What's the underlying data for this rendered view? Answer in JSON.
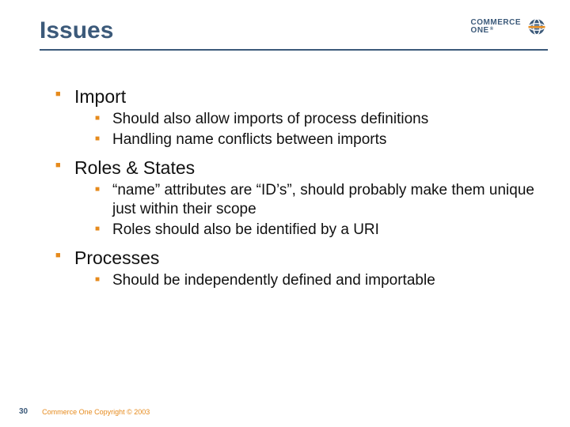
{
  "logo": {
    "line1": "COMMERCE",
    "line2": "ONE",
    "reg": "®"
  },
  "title": "Issues",
  "bullets": [
    {
      "label": "Import",
      "sub": [
        "Should also allow imports of process definitions",
        "Handling name conflicts between imports"
      ]
    },
    {
      "label": "Roles & States",
      "sub": [
        "“name” attributes are “ID’s”, should probably make them unique just within their scope",
        "Roles should also be identified by a URI"
      ]
    },
    {
      "label": "Processes",
      "sub": [
        "Should be independently defined and importable"
      ]
    }
  ],
  "footer": {
    "page": "30",
    "copyright": "Commerce One Copyright © 2003"
  }
}
